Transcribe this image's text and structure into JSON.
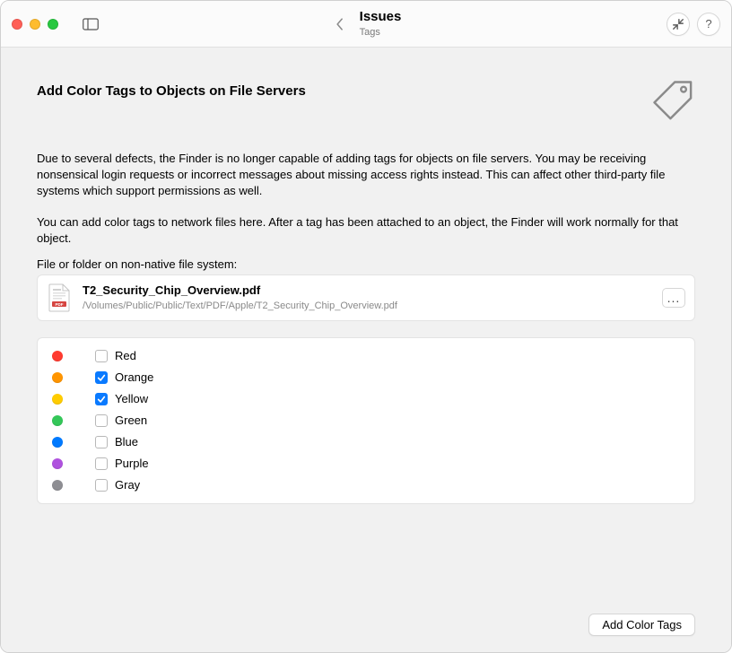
{
  "titlebar": {
    "title": "Issues",
    "subtitle": "Tags"
  },
  "page": {
    "heading": "Add Color Tags to Objects on File Servers",
    "paragraph1": "Due to several defects, the Finder is no longer capable of adding tags for objects on file servers. You may be receiving nonsensical login requests or incorrect messages about missing access rights instead. This can affect other third-party file systems which support permissions as well.",
    "paragraph2": "You can add color tags to network files here. After a tag has been attached to an object, the Finder will work normally for that object.",
    "field_label": "File or folder on non-native file system:",
    "file": {
      "name": "T2_Security_Chip_Overview.pdf",
      "path": "/Volumes/Public/Public/Text/PDF/Apple/T2_Security_Chip_Overview.pdf",
      "more": "..."
    },
    "tags": [
      {
        "color": "red",
        "label": "Red",
        "checked": false
      },
      {
        "color": "orange",
        "label": "Orange",
        "checked": true
      },
      {
        "color": "yellow",
        "label": "Yellow",
        "checked": true
      },
      {
        "color": "green",
        "label": "Green",
        "checked": false
      },
      {
        "color": "blue",
        "label": "Blue",
        "checked": false
      },
      {
        "color": "purple",
        "label": "Purple",
        "checked": false
      },
      {
        "color": "gray",
        "label": "Gray",
        "checked": false
      }
    ],
    "action_button": "Add Color Tags"
  },
  "icons": {
    "help": "?"
  }
}
